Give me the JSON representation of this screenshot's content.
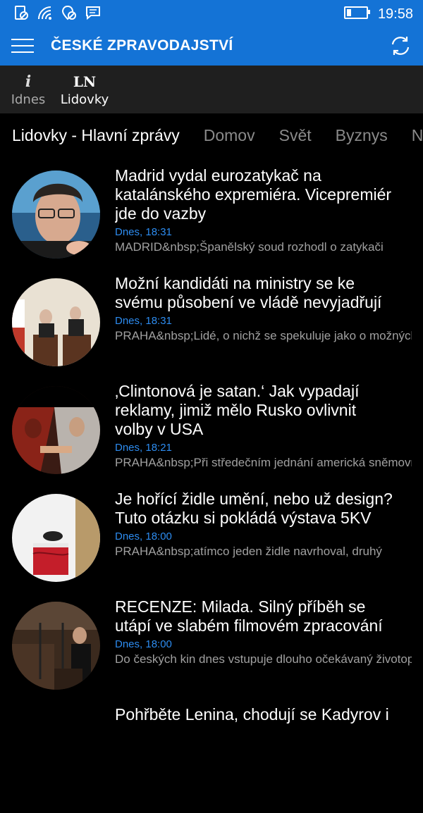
{
  "status_bar": {
    "time": "19:58",
    "icons": [
      "silent-mode-icon",
      "wifi-icon",
      "location-off-icon",
      "message-icon"
    ]
  },
  "app_bar": {
    "title": "ČESKÉ ZPRAVODAJSTVÍ"
  },
  "sources": [
    {
      "logo": "i",
      "label": "Idnes"
    },
    {
      "logo": "LN",
      "label": "Lidovky"
    }
  ],
  "tabs": [
    "Lidovky - Hlavní zprávy",
    "Domov",
    "Svět",
    "Byznys",
    "N"
  ],
  "articles": [
    {
      "headline": "Madrid vydal eurozatykač na\nkatalánského expremiéra. Vicepremiér\njde do vazby",
      "time": "Dnes, 18:31",
      "snippet": "MADRID&nbsp;Španělský soud rozhodl o zatykači"
    },
    {
      "headline": "Možní kandidáti na ministry se ke\nsvému působení ve vládě nevyjadřují",
      "time": "Dnes, 18:31",
      "snippet": "PRAHA&nbsp;Lidé, o nichž se spekuluje jako o možných"
    },
    {
      "headline": "‚Clintonová je satan.‘ Jak vypadají\nreklamy, jimiž mělo Rusko ovlivnit\nvolby v USA",
      "time": "Dnes, 18:21",
      "snippet": "PRAHA&nbsp;Při středečním jednání americká sněmovna"
    },
    {
      "headline": "Je hořící židle umění, nebo už design?\nTuto otázku si pokládá výstava 5KV",
      "time": "Dnes, 18:00",
      "snippet": "PRAHA&nbsp;atímco jeden židle navrhoval, druhý"
    },
    {
      "headline": "RECENZE: Milada. Silný příběh se\nutápí ve slabém filmovém zpracování",
      "time": "Dnes, 18:00",
      "snippet": "Do českých kin dnes vstupuje dlouho očekávaný životopisný"
    },
    {
      "headline": "Pohřběte Lenina, chodují se Kadyrov i",
      "time": "",
      "snippet": ""
    }
  ]
}
